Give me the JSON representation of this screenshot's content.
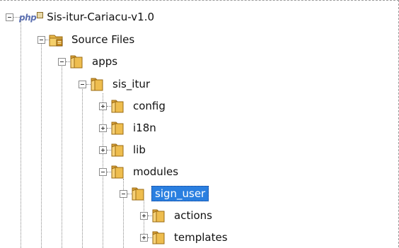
{
  "project": {
    "name": "Sis-itur-Cariacu-v1.0",
    "icon": "php-project-icon",
    "icon_text": "php"
  },
  "tree": [
    {
      "label": "Source Files",
      "icon": "source-files-folder-icon",
      "state": "expanded"
    },
    {
      "label": "apps",
      "icon": "folder-icon",
      "state": "expanded"
    },
    {
      "label": "sis_itur",
      "icon": "folder-icon",
      "state": "expanded"
    },
    {
      "label": "config",
      "icon": "folder-icon",
      "state": "collapsed"
    },
    {
      "label": "i18n",
      "icon": "folder-icon",
      "state": "collapsed"
    },
    {
      "label": "lib",
      "icon": "folder-icon",
      "state": "collapsed"
    },
    {
      "label": "modules",
      "icon": "folder-icon",
      "state": "expanded"
    },
    {
      "label": "sign_user",
      "icon": "folder-icon",
      "state": "expanded",
      "selected": true
    },
    {
      "label": "actions",
      "icon": "folder-icon",
      "state": "collapsed"
    },
    {
      "label": "templates",
      "icon": "folder-icon",
      "state": "collapsed"
    }
  ],
  "colors": {
    "selection": "#2a7fe0",
    "folder": "#e9b94a"
  }
}
